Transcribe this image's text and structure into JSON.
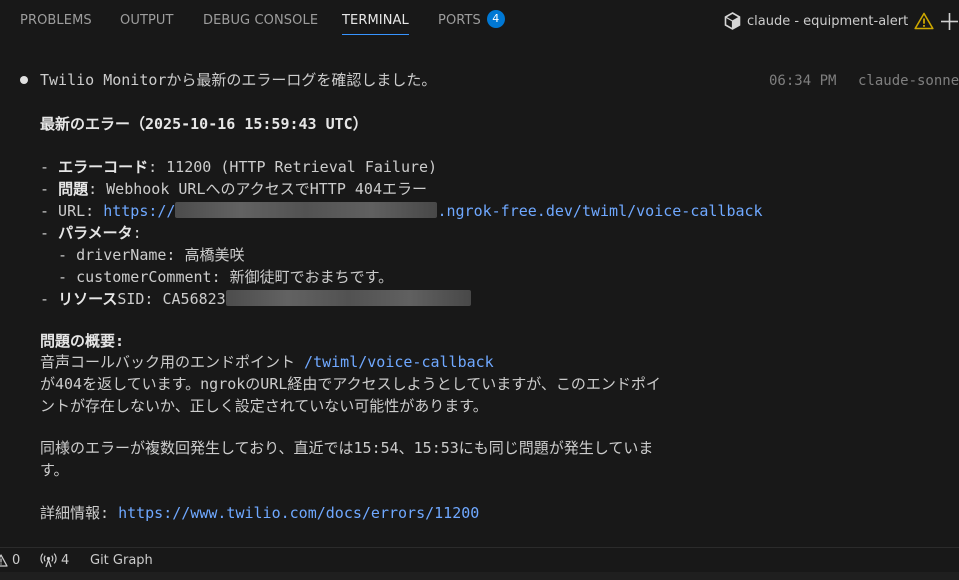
{
  "panel": {
    "tabs": [
      {
        "label": "PROBLEMS"
      },
      {
        "label": "OUTPUT"
      },
      {
        "label": "DEBUG CONSOLE"
      },
      {
        "label": "TERMINAL"
      },
      {
        "label": "PORTS"
      }
    ],
    "active_tab": "TERMINAL",
    "ports_badge": "4",
    "terminal_name": "claude - equipment-alert",
    "warning_icon": "warning-icon",
    "new_terminal_icon": "plus-icon"
  },
  "terminal": {
    "header_line": "Twilio Monitorから最新のエラーログを確認しました。",
    "time": "06:34 PM",
    "model": "claude-sonne",
    "latest_error_title": "最新のエラー（2025-10-16 15:59:43 UTC）",
    "error_code_prefix": "- ",
    "error_code_label": "エラーコード",
    "error_code_value": ": 11200 (HTTP Retrieval Failure)",
    "problem_label": "問題",
    "problem_value": ": Webhook URLへのアクセスでHTTP 404エラー",
    "url_label": "- URL: ",
    "url_start": "https://",
    "url_end": ".ngrok-free.dev/twiml/voice-callback",
    "params_label": "パラメータ",
    "param_driver_label": "  - driverName: ",
    "param_driver_value": "高橋美咲",
    "param_comment_label": "  - customerComment: ",
    "param_comment_value": "新御徒町でおまちです。",
    "resource_label": "リソース",
    "resource_sid_label": "SID: CA56823",
    "summary_title": "問題の概要",
    "summary_line1": "音声コールバック用のエンドポイント ",
    "summary_endpoint": "/twiml/voice-callback",
    "summary_line2": "が404を返しています。ngrokのURL経由でアクセスしようとしていますが、このエンドポイ",
    "summary_line3": "ントが存在しないか、正しく設定されていない可能性があります。",
    "repeat_line1": "同様のエラーが複数回発生しており、直近では15:54、15:53にも同じ問題が発生していま",
    "repeat_line2": "す。",
    "details_label": "詳細情報: ",
    "details_url": "https://www.twilio.com/docs/errors/11200"
  },
  "statusbar": {
    "warnings_count": "0",
    "ports_count": "4",
    "git_graph": "Git Graph"
  },
  "colors": {
    "background": "#181818",
    "accent": "#3794ff",
    "link": "#6fa8ff",
    "badge": "#0078d4",
    "warning": "#cca700"
  }
}
